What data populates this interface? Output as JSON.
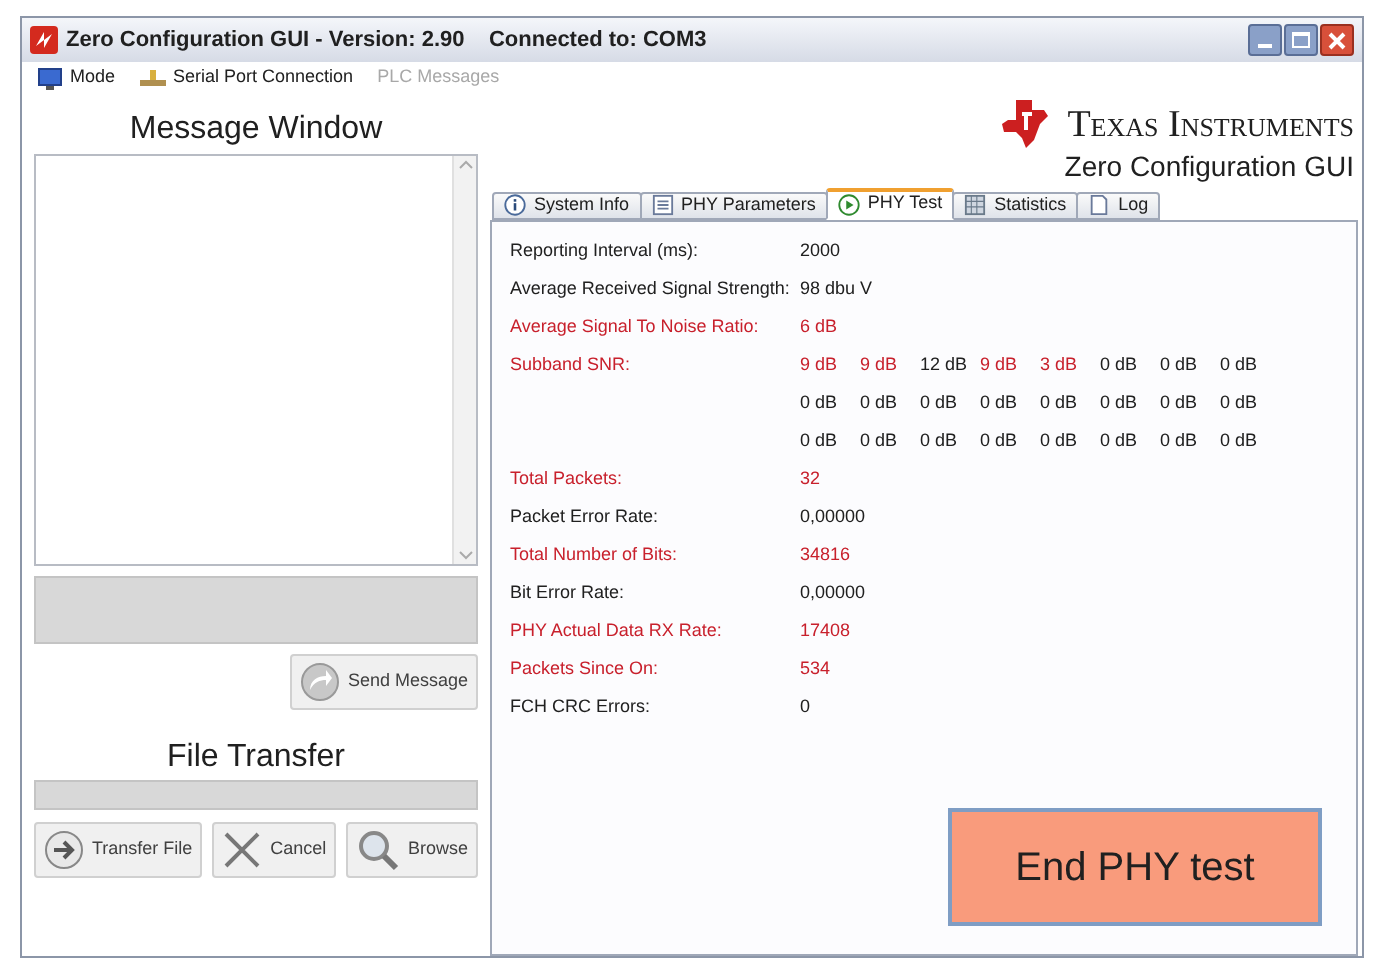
{
  "window": {
    "title": "Zero Configuration GUI - Version: 2.90    Connected to: COM3"
  },
  "menu": [
    {
      "label": "Mode",
      "disabled": false,
      "kind": "mode"
    },
    {
      "label": "Serial Port Connection",
      "disabled": false,
      "kind": "serial"
    },
    {
      "label": "PLC Messages",
      "disabled": true,
      "kind": "none"
    }
  ],
  "left": {
    "message_title": "Message Window",
    "send_button": "Send Message",
    "file_title": "File Transfer",
    "file_buttons": [
      {
        "label": "Transfer File",
        "kind": "transfer"
      },
      {
        "label": "Cancel",
        "kind": "cancel"
      },
      {
        "label": "Browse",
        "kind": "browse"
      }
    ]
  },
  "brand": {
    "name": "Texas Instruments",
    "subtitle": "Zero Configuration GUI"
  },
  "tabs": [
    {
      "label": "System Info",
      "selected": false,
      "kind": "info"
    },
    {
      "label": "PHY Parameters",
      "selected": false,
      "kind": "doc"
    },
    {
      "label": "PHY Test",
      "selected": true,
      "kind": "play"
    },
    {
      "label": "Statistics",
      "selected": false,
      "kind": "stats"
    },
    {
      "label": "Log",
      "selected": false,
      "kind": "log"
    }
  ],
  "rows": [
    {
      "label": "Reporting Interval (ms):",
      "highlighted": false,
      "values": [
        {
          "text": "2000",
          "highlighted": false
        }
      ]
    },
    {
      "label": "Average Received Signal Strength:",
      "highlighted": false,
      "values": [
        {
          "text": "98 dbu V",
          "highlighted": false
        }
      ]
    },
    {
      "label": "Average Signal To Noise Ratio:",
      "highlighted": true,
      "values": [
        {
          "text": "6 dB",
          "highlighted": true
        }
      ]
    },
    {
      "label": "Subband SNR:",
      "highlighted": true,
      "values": [
        {
          "text": "9 dB",
          "highlighted": true
        },
        {
          "text": "9 dB",
          "highlighted": true
        },
        {
          "text": "12 dB",
          "highlighted": false
        },
        {
          "text": "9 dB",
          "highlighted": true
        },
        {
          "text": "3 dB",
          "highlighted": true
        },
        {
          "text": "0 dB",
          "highlighted": false
        },
        {
          "text": "0 dB",
          "highlighted": false
        },
        {
          "text": "0 dB",
          "highlighted": false
        },
        {
          "text": "0 dB",
          "highlighted": false
        },
        {
          "text": "0 dB",
          "highlighted": false
        },
        {
          "text": "0 dB",
          "highlighted": false
        },
        {
          "text": "0 dB",
          "highlighted": false
        },
        {
          "text": "0 dB",
          "highlighted": false
        },
        {
          "text": "0 dB",
          "highlighted": false
        },
        {
          "text": "0 dB",
          "highlighted": false
        },
        {
          "text": "0 dB",
          "highlighted": false
        },
        {
          "text": "0 dB",
          "highlighted": false
        },
        {
          "text": "0 dB",
          "highlighted": false
        },
        {
          "text": "0 dB",
          "highlighted": false
        },
        {
          "text": "0 dB",
          "highlighted": false
        },
        {
          "text": "0 dB",
          "highlighted": false
        },
        {
          "text": "0 dB",
          "highlighted": false
        },
        {
          "text": "0 dB",
          "highlighted": false
        },
        {
          "text": "0 dB",
          "highlighted": false
        }
      ]
    },
    {
      "label": "Total Packets:",
      "highlighted": true,
      "values": [
        {
          "text": "32",
          "highlighted": true
        }
      ]
    },
    {
      "label": "Packet Error Rate:",
      "highlighted": false,
      "values": [
        {
          "text": "0,00000",
          "highlighted": false
        }
      ]
    },
    {
      "label": "Total Number of Bits:",
      "highlighted": true,
      "values": [
        {
          "text": "34816",
          "highlighted": true
        }
      ]
    },
    {
      "label": "Bit Error Rate:",
      "highlighted": false,
      "values": [
        {
          "text": "0,00000",
          "highlighted": false
        }
      ]
    },
    {
      "label": "PHY Actual Data RX Rate:",
      "highlighted": true,
      "values": [
        {
          "text": "17408",
          "highlighted": true
        }
      ]
    },
    {
      "label": "Packets Since On:",
      "highlighted": true,
      "values": [
        {
          "text": "534",
          "highlighted": true
        }
      ]
    },
    {
      "label": "FCH CRC Errors:",
      "highlighted": false,
      "values": [
        {
          "text": "0",
          "highlighted": false
        }
      ]
    }
  ],
  "end_button": "End PHY test"
}
